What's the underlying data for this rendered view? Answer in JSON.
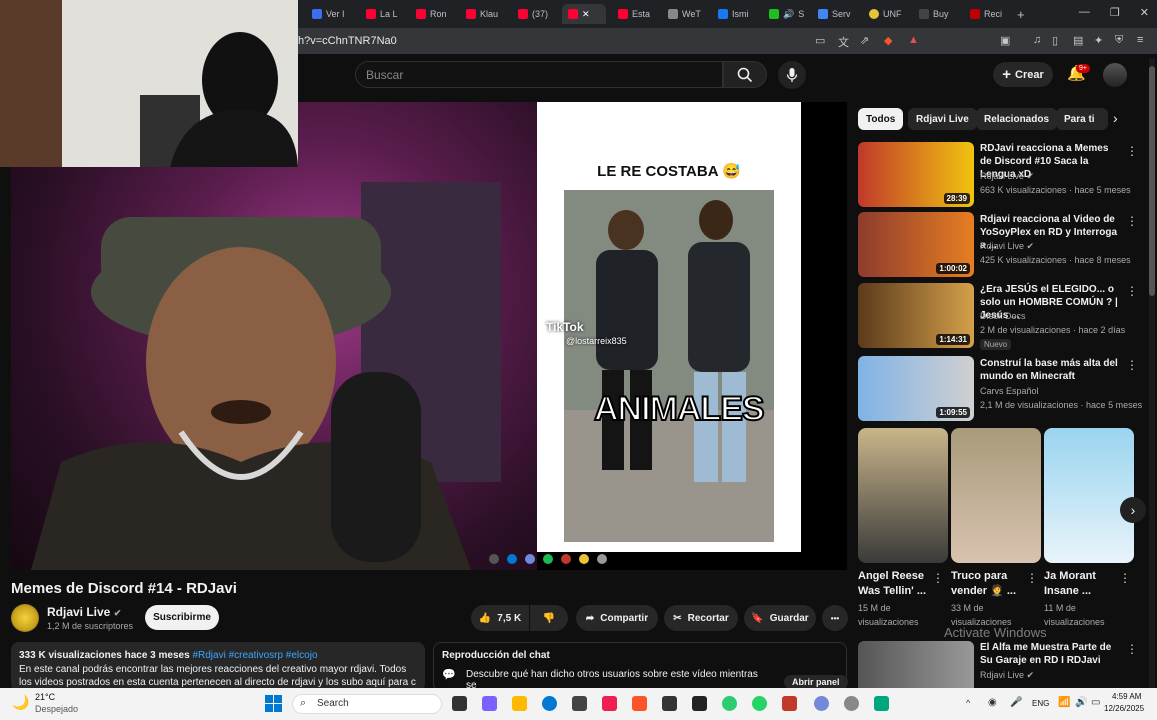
{
  "browser": {
    "tabs": [
      {
        "label": "Ver I",
        "color": "#3b6ff2"
      },
      {
        "label": "La L",
        "color": "#ff0033"
      },
      {
        "label": "Ron",
        "color": "#ff0033"
      },
      {
        "label": "Klau",
        "color": "#ff0033"
      },
      {
        "label": "(37)",
        "color": "#ff0033"
      },
      {
        "label": "",
        "color": "#ff0033"
      },
      {
        "label": "Esta",
        "color": "#ff0033"
      },
      {
        "label": "WeT",
        "color": "#888888"
      },
      {
        "label": "Ismi",
        "color": "#1877f2"
      },
      {
        "label": "S",
        "color": "#1fbf1f"
      },
      {
        "label": "Serv",
        "color": "#4285f4"
      },
      {
        "label": "UNF",
        "color": "#e8c33a"
      },
      {
        "label": "Buy",
        "color": "#444444"
      },
      {
        "label": "Reci",
        "color": "#c00000"
      }
    ],
    "active_tab_close": "✕",
    "new_tab": "+",
    "url": "h?v=cChnTNR7Na0",
    "window_controls": {
      "minimize": "—",
      "maximize": "❐",
      "close": "✕"
    }
  },
  "header": {
    "search_placeholder": "Buscar",
    "create_label": "Crear",
    "notif_badge": "9+",
    "icons": {
      "search": "search-icon",
      "mic": "mic-icon",
      "plus": "plus-icon",
      "bell": "bell-icon"
    }
  },
  "player": {
    "tiktok_title": "LE RE COSTABA 😅",
    "tiktok_watermark": "TikTok",
    "tiktok_user": "@lostarreix835",
    "caption": "ANIMALES"
  },
  "video": {
    "title": "Memes de Discord #14 - RDJavi",
    "channel": "Rdjavi Live",
    "verified": "✔",
    "subscribers": "1,2 M de suscriptores",
    "subscribe_label": "Suscribirme",
    "likes": "7,5 K",
    "share_label": "Compartir",
    "clip_label": "Recortar",
    "save_label": "Guardar",
    "more": "•••"
  },
  "description": {
    "meta": "333 K visualizaciones  hace 3 meses ",
    "tags": "#Rdjavi #creativosrp #elcojo",
    "text": "En este canal podrás encontrar las mejores reacciones del creativo mayor rdjavi. Todos los videos postrados en esta cuenta pertenecen al directo de rdjavi y los subo aquí para c  ...más"
  },
  "chat": {
    "title": "Reproducción del chat",
    "text": "Descubre qué han dicho otros usuarios sobre este vídeo mientras se",
    "button": "Abrir panel"
  },
  "sidebar": {
    "chips": [
      "Todos",
      "Rdjavi Live",
      "Relacionados",
      "Para ti"
    ],
    "related": [
      {
        "title": "RDJavi reacciona a Memes de Discord #10  Saca la Lengua xD",
        "channel": "Rdjavi Live ✔",
        "meta": "663 K visualizaciones · hace 5 meses",
        "duration": "28:39",
        "c1": "#c0392b",
        "c2": "#f1c40f"
      },
      {
        "title": "Rdjavi reacciona al Video de YoSoyPlex en RD y Interroga a ...",
        "channel": "Rdjavi Live ✔",
        "meta": "425 K visualizaciones · hace 8 meses",
        "duration": "1:00:02",
        "c1": "#8e3b2e",
        "c2": "#e67e22"
      },
      {
        "title": "¿Era JESÚS el ELEGIDO... o solo un HOMBRE COMÚN ? | Jesús ...",
        "channel": "Dieck Docs",
        "meta": "2 M de visualizaciones · hace 2 días",
        "duration": "1:14:31",
        "c1": "#5b3a1c",
        "c2": "#d4a04a"
      },
      {
        "title": "Construí la base más alta del mundo en Minecraft",
        "channel": "Carvs Español",
        "meta": "2,1 M de visualizaciones · hace 5 meses",
        "duration": "1:09:55",
        "c1": "#7fb3e6",
        "c2": "#d0d0d0"
      }
    ],
    "new_badge": "Nuevo",
    "shorts": [
      {
        "title": "Angel Reese Was Tellin' ...",
        "views": "15 M de visualizaciones",
        "c1": "#c9b58a",
        "c2": "#3a3a3a"
      },
      {
        "title": "Truco para vender 🤵 ...",
        "views": "33 M de visualizaciones",
        "c1": "#a89a7a",
        "c2": "#d9c3b0"
      },
      {
        "title": "Ja Morant Insane ...",
        "views": "11 M de visualizaciones",
        "c1": "#9ad4ef",
        "c2": "#e8f4fa"
      }
    ],
    "partial_title": "El Alfa me Muestra Parte de Su Garaje en RD I RDJavi",
    "partial_channel": "Rdjavi Live ✔"
  },
  "watermark": "Activate Windows",
  "taskbar": {
    "temp": "21°C",
    "weather": "Despejado",
    "search": "Search",
    "lang": "ENG",
    "time": "4:59 AM",
    "date": "12/26/2025",
    "apps": [
      "#ffb900",
      "#0078d4",
      "#e8c33a",
      "#1db954",
      "#ee1d52",
      "#fb542b",
      "#333333",
      "#444444",
      "#2ecc71",
      "#25d366",
      "#c0392b",
      "#7289da",
      "#888888",
      "#00a67e"
    ]
  }
}
